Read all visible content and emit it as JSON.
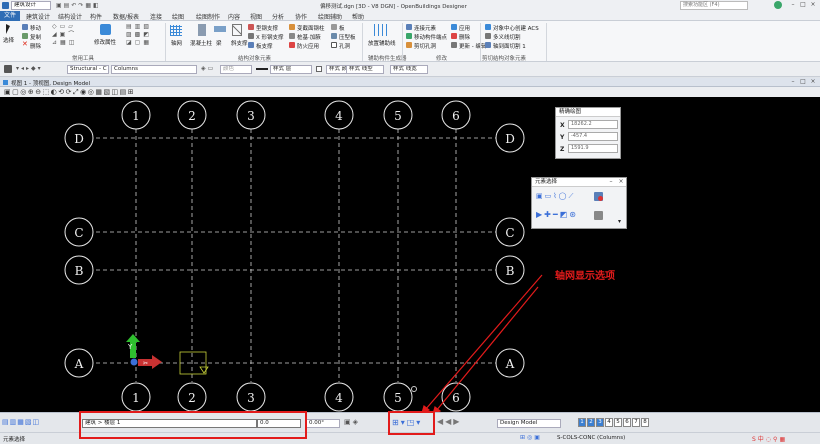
{
  "titlebar": {
    "app_mode": "建筑设计",
    "title": "偏移测试.dgn [3D - V8 DGN] - OpenBuildings Designer",
    "search_placeholder": "搜索功能区 (F4)"
  },
  "ribbon_tabs": [
    "文件",
    "建筑设计",
    "结构设计",
    "构件",
    "数据/报表",
    "连接",
    "绘图",
    "绘图制作",
    "内容",
    "视图",
    "分析",
    "协作",
    "绘图辅助",
    "帮助"
  ],
  "ribbon": {
    "common": {
      "select": "选择",
      "move": "移动",
      "copy": "复制",
      "delete": "删除",
      "modify_props": "修改属性",
      "group_label": "常用工具"
    },
    "structural": {
      "grid": "轴网",
      "concrete_column": "混凝土柱",
      "beam": "梁",
      "brace": "斜支撑",
      "profile_brace": "型钢支撑",
      "x_brace": "X 形钢支撑",
      "slab_brace": "板支撑",
      "deform": "变截面钢柱",
      "pile_base": "桩基·加腋",
      "fireproof": "防火应用",
      "plate": "板",
      "curved_plate": "压型板",
      "hole": "孔洞",
      "group_label": "结构对象元素"
    },
    "generator": {
      "label": "放置辅助线",
      "group_label": "辅助构件生成器"
    },
    "modify": {
      "connect": "连接元素",
      "move_endpoint": "移动构件端点",
      "cut_hole": "剪切孔洞",
      "apply": "应用",
      "delete": "删除",
      "update": "更新 - 编辑",
      "group_label": "修改"
    },
    "clip": {
      "create_clip": "对象中心创建 ACS",
      "multi_clip": "多义线切割",
      "grid_clip": "轴到面切割 1",
      "group_label": "剪切结构对象元素"
    }
  },
  "propbar": {
    "family": "Structural - C",
    "part": "Columns",
    "color_label": "颜色",
    "style_label1": "样式 层",
    "style_label2": "样式 颜色",
    "style_label3": "样式 线型",
    "style_label4": "样式 线宽"
  },
  "view": {
    "title": "视图 1 - 顶视图, Design Model"
  },
  "grid": {
    "columns": [
      "1",
      "2",
      "3",
      "4",
      "5",
      "6"
    ],
    "rows": [
      "D",
      "C",
      "B",
      "A"
    ]
  },
  "ucs": {
    "y_label": "Y"
  },
  "accudraw": {
    "title": "精确绘图",
    "x_label": "X",
    "x_value": "18262.2",
    "y_label": "Y",
    "y_value": "-457.4",
    "z_label": "Z",
    "z_value": "1591.9"
  },
  "element_selection": {
    "title": "元素选择"
  },
  "annotation": {
    "text": "轴网显示选项"
  },
  "statusbar": {
    "level_path": "建筑 > 楼层 1",
    "level_value": "0.0",
    "angle": "0.00°",
    "model": "Design Model",
    "views": [
      "1",
      "2",
      "3",
      "4",
      "5",
      "6",
      "7",
      "8"
    ]
  },
  "bottombar": {
    "mode": "元素选择",
    "level": "S-COLS-CONC (Columns)"
  },
  "colors": {
    "accent": "#2f6db5",
    "grid_line": "#d0d0d0",
    "annotation": "#e21b1b"
  }
}
